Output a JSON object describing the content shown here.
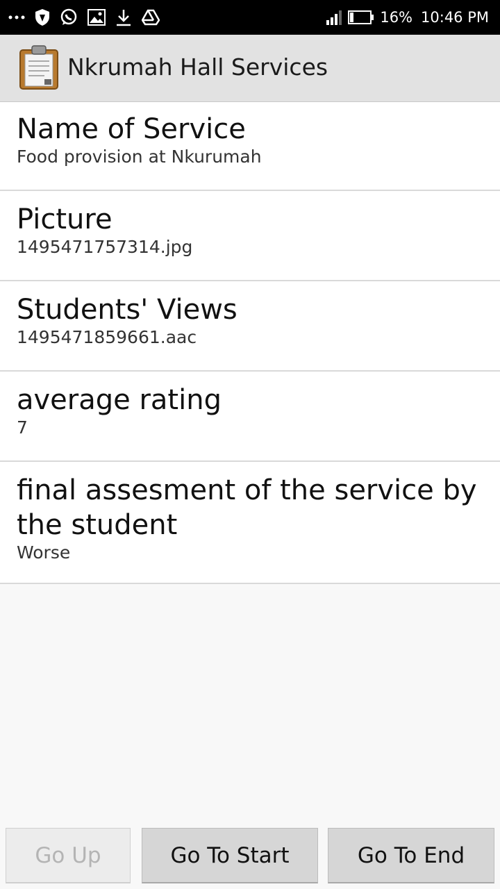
{
  "status_bar": {
    "battery": "16%",
    "time": "10:46 PM",
    "left_icons": [
      "more-dots-icon",
      "shield-icon",
      "whatsapp-icon",
      "image-icon",
      "download-icon",
      "drive-icon"
    ]
  },
  "app": {
    "title": "Nkrumah Hall Services",
    "icon": "clipboard-icon"
  },
  "fields": [
    {
      "label": "Name of Service",
      "value": "Food provision at Nkurumah"
    },
    {
      "label": "Picture",
      "value": "1495471757314.jpg"
    },
    {
      "label": "Students' Views",
      "value": "1495471859661.aac"
    },
    {
      "label": "average rating",
      "value": "7"
    },
    {
      "label": "final assesment of the service by the student",
      "value": "Worse"
    }
  ],
  "buttons": {
    "go_up": "Go Up",
    "go_to_start": "Go To Start",
    "go_to_end": "Go To End"
  }
}
